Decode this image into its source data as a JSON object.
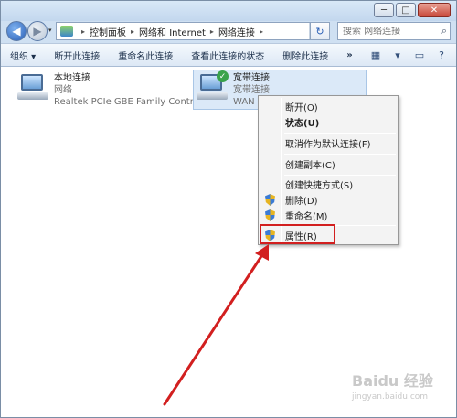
{
  "window": {
    "controls": {
      "minimize": "─",
      "maximize": "□",
      "close": "✕"
    }
  },
  "nav": {
    "back_icon": "back-arrow-icon",
    "forward_icon": "forward-arrow-icon",
    "breadcrumb": [
      "控制面板",
      "网络和 Internet",
      "网络连接"
    ],
    "separator": "▸",
    "dropdown": "▾",
    "refresh": "↻",
    "search_placeholder": "搜索 网络连接"
  },
  "toolbar": {
    "items": [
      "组织 ▾",
      "断开此连接",
      "重命名此连接",
      "查看此连接的状态",
      "删除此连接"
    ],
    "more": "»",
    "icons": [
      "view-options-icon",
      "preview-pane-icon",
      "help-icon"
    ]
  },
  "connections": [
    {
      "name": "本地连接",
      "line2": "网络",
      "line3": "Realtek PCIe GBE Family Contr..."
    },
    {
      "name": "宽带连接",
      "line2": "宽带连接",
      "line3": "WAN M"
    }
  ],
  "context_menu": {
    "items": [
      {
        "label": "断开(O)",
        "bold": false,
        "shield": false
      },
      {
        "label": "状态(U)",
        "bold": true,
        "shield": false
      },
      {
        "label": "取消作为默认连接(F)",
        "bold": false,
        "shield": false
      },
      {
        "label": "创建副本(C)",
        "bold": false,
        "shield": false
      },
      {
        "label": "创建快捷方式(S)",
        "bold": false,
        "shield": false
      },
      {
        "label": "删除(D)",
        "bold": false,
        "shield": true
      },
      {
        "label": "重命名(M)",
        "bold": false,
        "shield": true
      },
      {
        "label": "属性(R)",
        "bold": false,
        "shield": true
      }
    ],
    "highlight_color": "#d21f1f"
  },
  "annotation": {
    "arrow_color": "#d21f1f"
  },
  "watermark": {
    "text": "Baidu 经验",
    "sub": "jingyan.baidu.com"
  }
}
